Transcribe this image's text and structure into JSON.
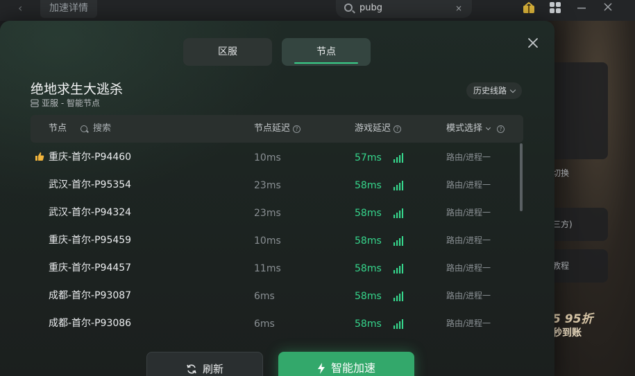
{
  "background": {
    "tab_label": "加速详情",
    "search_value": "pubg",
    "clear_label": "×",
    "back_label": "‹",
    "side_cards": [
      "切换",
      "三方)",
      "教程"
    ],
    "promo_discount": "5 95折",
    "promo_sub": "秒到账"
  },
  "tabs": [
    {
      "label": "区服",
      "active": false
    },
    {
      "label": "节点",
      "active": true
    }
  ],
  "game": {
    "title": "绝地求生大逃杀",
    "server": "亚服 - 智能节点",
    "history_label": "历史线路"
  },
  "table": {
    "col_node": "节点",
    "search_placeholder": "搜索",
    "col_node_delay": "节点延迟",
    "col_game_delay": "游戏延迟",
    "col_mode": "模式选择",
    "rows": [
      {
        "name": "重庆-首尔-P94460",
        "node_delay": "10ms",
        "game_delay": "57ms",
        "mode": "路由/进程一",
        "recommended": true
      },
      {
        "name": "武汉-首尔-P95354",
        "node_delay": "23ms",
        "game_delay": "58ms",
        "mode": "路由/进程一",
        "recommended": false
      },
      {
        "name": "武汉-首尔-P94324",
        "node_delay": "23ms",
        "game_delay": "58ms",
        "mode": "路由/进程一",
        "recommended": false
      },
      {
        "name": "重庆-首尔-P95459",
        "node_delay": "10ms",
        "game_delay": "58ms",
        "mode": "路由/进程一",
        "recommended": false
      },
      {
        "name": "重庆-首尔-P94457",
        "node_delay": "11ms",
        "game_delay": "58ms",
        "mode": "路由/进程一",
        "recommended": false
      },
      {
        "name": "成都-首尔-P93087",
        "node_delay": "6ms",
        "game_delay": "58ms",
        "mode": "路由/进程一",
        "recommended": false
      },
      {
        "name": "成都-首尔-P93086",
        "node_delay": "6ms",
        "game_delay": "58ms",
        "mode": "路由/进程一",
        "recommended": false
      }
    ]
  },
  "actions": {
    "refresh_label": "刷新",
    "accelerate_label": "智能加速"
  },
  "colors": {
    "accent": "#33a86b",
    "delay_good": "#36d68c"
  }
}
